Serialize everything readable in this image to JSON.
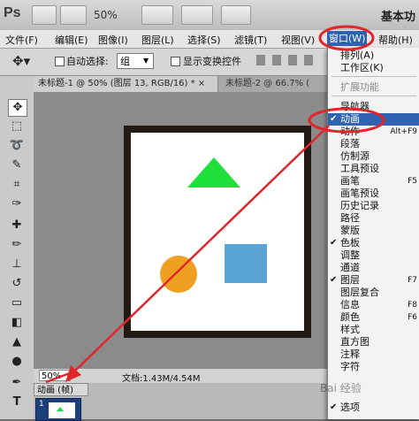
{
  "app": {
    "logo": "Ps",
    "zoom": "50%",
    "workspace": "基本功"
  },
  "menubar": {
    "items": [
      "文件(F)",
      "编辑(E)",
      "图像(I)",
      "图层(L)",
      "选择(S)",
      "滤镜(T)",
      "视图(V)",
      "窗口(W)",
      "帮助(H)"
    ]
  },
  "options": {
    "auto_select_label": "自动选择:",
    "auto_select_value": "组",
    "show_transform_label": "显示变换控件"
  },
  "tabs": {
    "tab1": "未标题-1 @ 50% (图层 13, RGB/16) * ×",
    "tab2": "未标题-2 @ 66.7% ("
  },
  "status": {
    "zoom": "50%",
    "doc": "文档:1.43M/4.54M"
  },
  "animation": {
    "tab_label": "动画 (帧)",
    "frame_number": "1"
  },
  "window_menu": {
    "items": [
      {
        "label": "排列(A)",
        "shortcut": "",
        "checked": false,
        "disabled": false,
        "highlight": false
      },
      {
        "label": "工作区(K)",
        "shortcut": "",
        "checked": false,
        "disabled": false,
        "highlight": false
      },
      {
        "label": "扩展功能",
        "shortcut": "",
        "checked": false,
        "disabled": true,
        "highlight": false
      },
      {
        "label": "导航器",
        "shortcut": "",
        "checked": false,
        "disabled": false,
        "highlight": false
      },
      {
        "label": "动画",
        "shortcut": "",
        "checked": true,
        "disabled": false,
        "highlight": true
      },
      {
        "label": "动作",
        "shortcut": "Alt+F9",
        "checked": false,
        "disabled": false,
        "highlight": false
      },
      {
        "label": "段落",
        "shortcut": "",
        "checked": false,
        "disabled": false,
        "highlight": false
      },
      {
        "label": "仿制源",
        "shortcut": "",
        "checked": false,
        "disabled": false,
        "highlight": false
      },
      {
        "label": "工具预设",
        "shortcut": "",
        "checked": false,
        "disabled": false,
        "highlight": false
      },
      {
        "label": "画笔",
        "shortcut": "F5",
        "checked": false,
        "disabled": false,
        "highlight": false
      },
      {
        "label": "画笔预设",
        "shortcut": "",
        "checked": false,
        "disabled": false,
        "highlight": false
      },
      {
        "label": "历史记录",
        "shortcut": "",
        "checked": false,
        "disabled": false,
        "highlight": false
      },
      {
        "label": "路径",
        "shortcut": "",
        "checked": false,
        "disabled": false,
        "highlight": false
      },
      {
        "label": "蒙版",
        "shortcut": "",
        "checked": false,
        "disabled": false,
        "highlight": false
      },
      {
        "label": "色板",
        "shortcut": "",
        "checked": true,
        "disabled": false,
        "highlight": false
      },
      {
        "label": "调整",
        "shortcut": "",
        "checked": false,
        "disabled": false,
        "highlight": false
      },
      {
        "label": "通道",
        "shortcut": "",
        "checked": false,
        "disabled": false,
        "highlight": false
      },
      {
        "label": "图层",
        "shortcut": "F7",
        "checked": true,
        "disabled": false,
        "highlight": false
      },
      {
        "label": "图层复合",
        "shortcut": "",
        "checked": false,
        "disabled": false,
        "highlight": false
      },
      {
        "label": "信息",
        "shortcut": "F8",
        "checked": false,
        "disabled": false,
        "highlight": false
      },
      {
        "label": "颜色",
        "shortcut": "F6",
        "checked": false,
        "disabled": false,
        "highlight": false
      },
      {
        "label": "样式",
        "shortcut": "",
        "checked": false,
        "disabled": false,
        "highlight": false
      },
      {
        "label": "直方图",
        "shortcut": "",
        "checked": false,
        "disabled": false,
        "highlight": false
      },
      {
        "label": "注释",
        "shortcut": "",
        "checked": false,
        "disabled": false,
        "highlight": false
      },
      {
        "label": "字符",
        "shortcut": "",
        "checked": false,
        "disabled": false,
        "highlight": false
      },
      {
        "label": "选项",
        "shortcut": "",
        "checked": true,
        "disabled": false,
        "highlight": false
      }
    ]
  },
  "watermark": "Bai 经验",
  "colors": {
    "triangle": "#1fe03a",
    "square": "#5aa5d6",
    "circle": "#f0a020",
    "annotation": "#e0262a",
    "highlight": "#2f62b0"
  }
}
